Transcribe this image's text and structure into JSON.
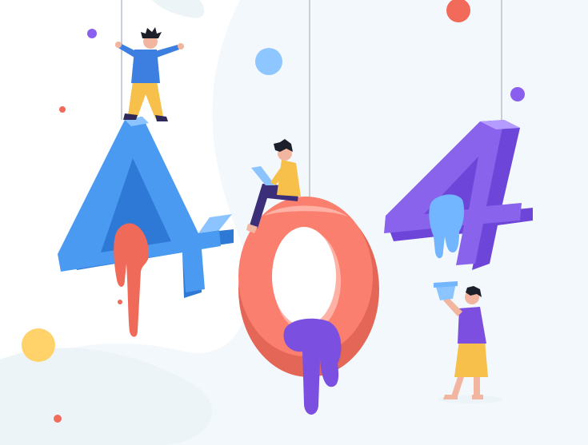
{
  "illustration": {
    "digits": [
      "4",
      "0",
      "4"
    ],
    "colors": {
      "background": "#ffffff",
      "bg_wash": "#f2f8fb",
      "bg_blob": "#edf4f8",
      "digit_blue": "#4a9af2",
      "digit_blue_side": "#2f79d6",
      "digit_blue_light": "#8cc4ff",
      "digit_coral": "#fa7f6f",
      "digit_coral_side": "#e36656",
      "digit_coral_light": "#ffb1a6",
      "digit_purple": "#8a63ec",
      "digit_purple_side": "#6d45d8",
      "digit_purple_light": "#b39bff",
      "drip_red": "#f06a5a",
      "drip_purple": "#7b4fe0",
      "drip_blue": "#72b6ff",
      "rope": "#c9cfd6",
      "dot_red": "#f26a5a",
      "dot_purple": "#8a5ff0",
      "dot_blue": "#8ec6ff",
      "dot_yellow": "#ffd26a",
      "skin": "#f2b6a0",
      "hair": "#1d1f2a",
      "shirt_blue": "#3d7fe0",
      "shirt_yellow": "#f6c04a",
      "shirt_purple": "#7c4fe0",
      "pants_yellow": "#f6c04a",
      "pants_navy": "#3b2f7a",
      "shoes": "#2d2a5a"
    },
    "people": [
      "person-standing-on-four",
      "person-sitting-with-laptop",
      "person-holding-paint-bucket"
    ]
  }
}
